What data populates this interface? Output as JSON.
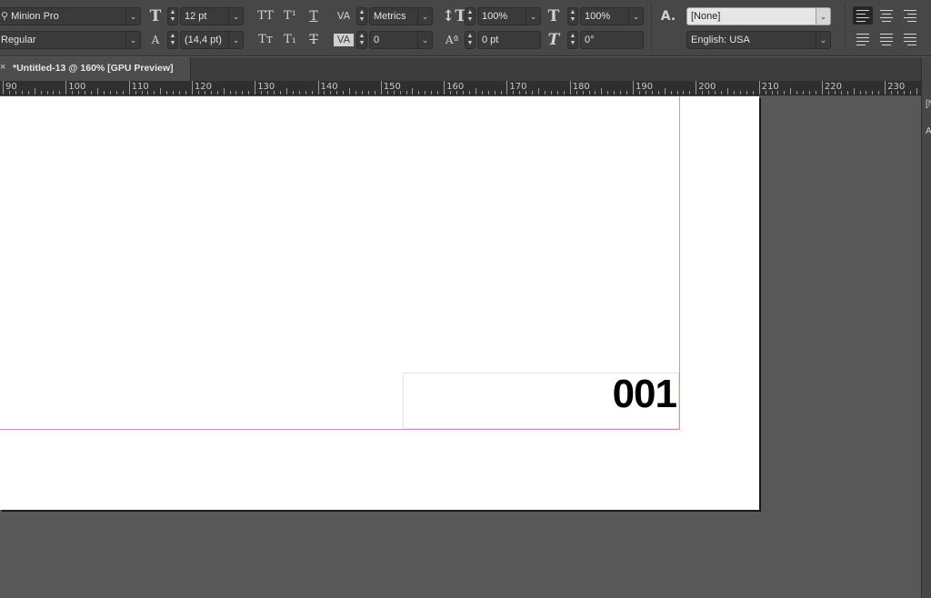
{
  "character_panel": {
    "font_family": "Minion Pro",
    "font_style": "Regular",
    "font_size": "12 pt",
    "leading": "(14,4 pt)",
    "kerning": "Metrics",
    "tracking": "0",
    "vertical_scale": "100%",
    "horizontal_scale": "100%",
    "baseline_shift": "0 pt",
    "skew": "0°",
    "character_style": "[None]",
    "language": "English: USA",
    "all_caps_glyph": "TT",
    "superscript_glyph": "T¹",
    "underline_glyph": "T",
    "small_caps_glyph": "Tт",
    "subscript_glyph": "T₁",
    "strikethrough_glyph": "T",
    "char_style_glyph": "A."
  },
  "document_tab": {
    "close_glyph": "×",
    "title": "*Untitled-13 @ 160% [GPU Preview]"
  },
  "ruler": {
    "labels": [
      "90",
      "100",
      "110",
      "120",
      "130",
      "140",
      "150",
      "160",
      "170",
      "180",
      "190",
      "200",
      "210",
      "220",
      "230"
    ]
  },
  "page": {
    "page_number_text": "001"
  },
  "side_panel": {
    "text_1": "[N",
    "text_2": "A"
  },
  "colors": {
    "panel_bg": "#474747",
    "pasteboard": "#585858",
    "margin_guide": "#d88ad8",
    "page": "#ffffff"
  }
}
